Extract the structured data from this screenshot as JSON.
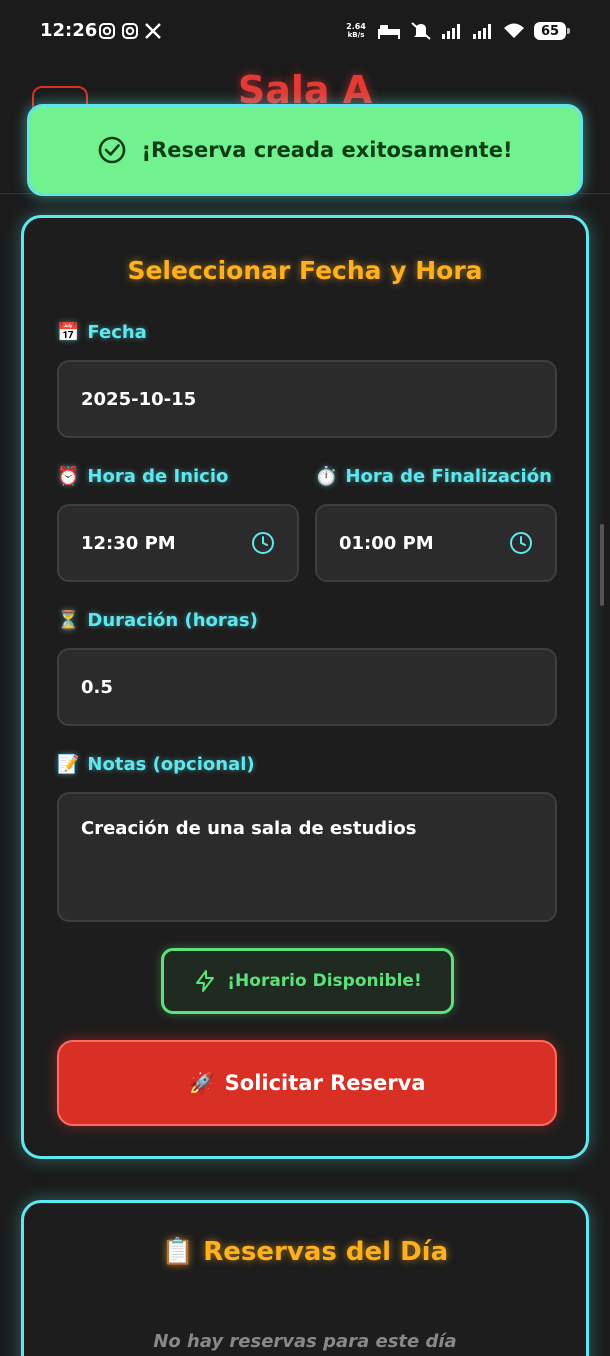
{
  "status_bar": {
    "time": "12:26",
    "net_speed": "2.64",
    "net_unit": "kB/s",
    "battery": "65"
  },
  "header": {
    "title": "Sala A"
  },
  "toast": {
    "message": "¡Reserva creada exitosamente!",
    "icon": "check-circle-icon"
  },
  "form": {
    "title": "Seleccionar Fecha y Hora",
    "date": {
      "emoji": "📅",
      "label": "Fecha",
      "value": "2025-10-15"
    },
    "start": {
      "emoji": "⏰",
      "label": "Hora de Inicio",
      "value": "12:30 PM"
    },
    "end": {
      "emoji": "⏱️",
      "label": "Hora de Finalización",
      "value": "01:00 PM"
    },
    "duration": {
      "emoji": "⏳",
      "label": "Duración (horas)",
      "value": "0.5"
    },
    "notes": {
      "emoji": "📝",
      "label": "Notas (opcional)",
      "value": "Creación de una sala de estudios"
    },
    "availability": "¡Horario Disponible!",
    "submit_emoji": "🚀",
    "submit_label": "Solicitar Reserva"
  },
  "reservations": {
    "emoji": "📋",
    "title": "Reservas del Día",
    "empty_text": "No hay reservas para este día"
  },
  "colors": {
    "accent_cyan": "#5ee7ee",
    "accent_orange": "#ffb020",
    "success_green": "#72f28f",
    "danger_red": "#d93025"
  }
}
